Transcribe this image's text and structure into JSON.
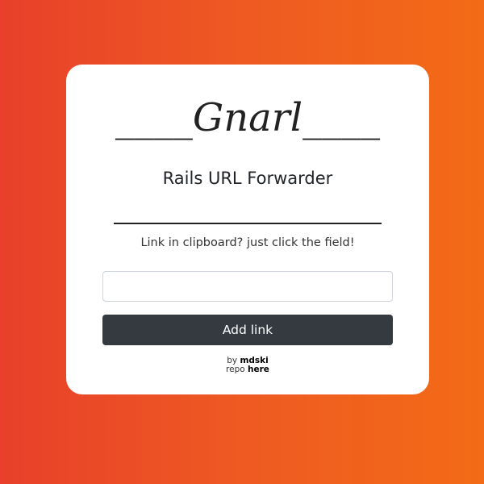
{
  "header": {
    "logo_text": "____Gnarl____",
    "subtitle": "Rails URL Forwarder"
  },
  "hint": {
    "text": "Link in clipboard? just click the field!"
  },
  "form": {
    "url_input_value": "",
    "url_input_placeholder": "",
    "submit_label": "Add link"
  },
  "credits": {
    "by_prefix": "by",
    "author_link": "mdski",
    "repo_prefix": "repo",
    "repo_link": "here"
  },
  "colors": {
    "gradient_start": "#e8402a",
    "gradient_end": "#f36b16",
    "card_background": "#ffffff",
    "button_background": "#343a40",
    "button_text": "#ffffff"
  }
}
